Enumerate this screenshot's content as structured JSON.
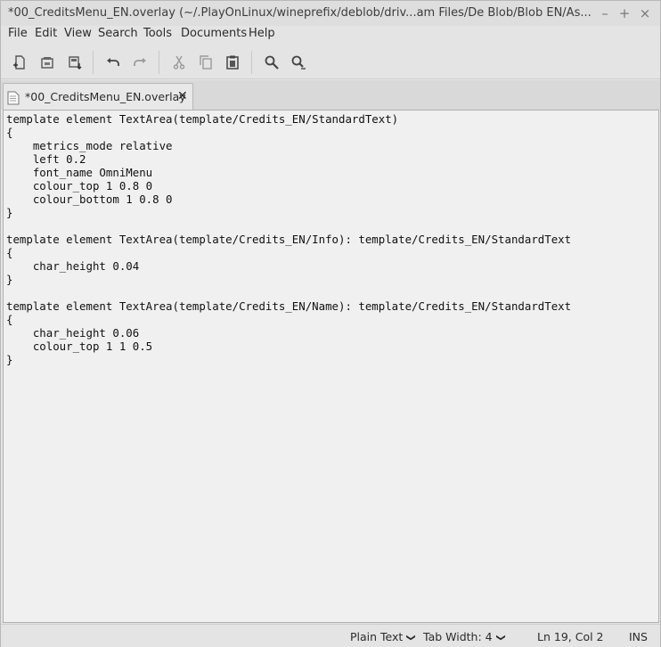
{
  "window": {
    "title": "*00_CreditsMenu_EN.overlay (~/.PlayOnLinux/wineprefix/deblob/driv...am Files/De Blob/Blob EN/As...",
    "min_glyph": "–",
    "max_glyph": "+",
    "close_glyph": "×"
  },
  "menu": [
    "File",
    "Edit",
    "View",
    "Search",
    "Tools",
    "Documents",
    "Help"
  ],
  "toolbar": {
    "icons": [
      "new-document-icon",
      "open-document-icon",
      "save-document-icon",
      "undo-icon",
      "redo-icon",
      "cut-icon",
      "copy-icon",
      "paste-icon",
      "find-icon",
      "find-replace-icon"
    ]
  },
  "tab": {
    "label": "*00_CreditsMenu_EN.overlay",
    "close_glyph": "✕"
  },
  "editor": {
    "lines": [
      "template element TextArea(template/Credits_EN/StandardText)",
      "{",
      "    metrics_mode relative",
      "    left 0.2",
      "    font_name OmniMenu",
      "    colour_top 1 0.8 0",
      "    colour_bottom 1 0.8 0",
      "}",
      "",
      "template element TextArea(template/Credits_EN/Info): template/Credits_EN/StandardText",
      "{",
      "    char_height 0.04",
      "}",
      "",
      "template element TextArea(template/Credits_EN/Name): template/Credits_EN/StandardText",
      "{",
      "    char_height 0.06",
      "    colour_top 1 1 0.5",
      "}"
    ]
  },
  "status": {
    "language": "Plain Text",
    "tab_width": "Tab Width:  4",
    "position": "Ln 19, Col 2",
    "mode": "INS"
  }
}
